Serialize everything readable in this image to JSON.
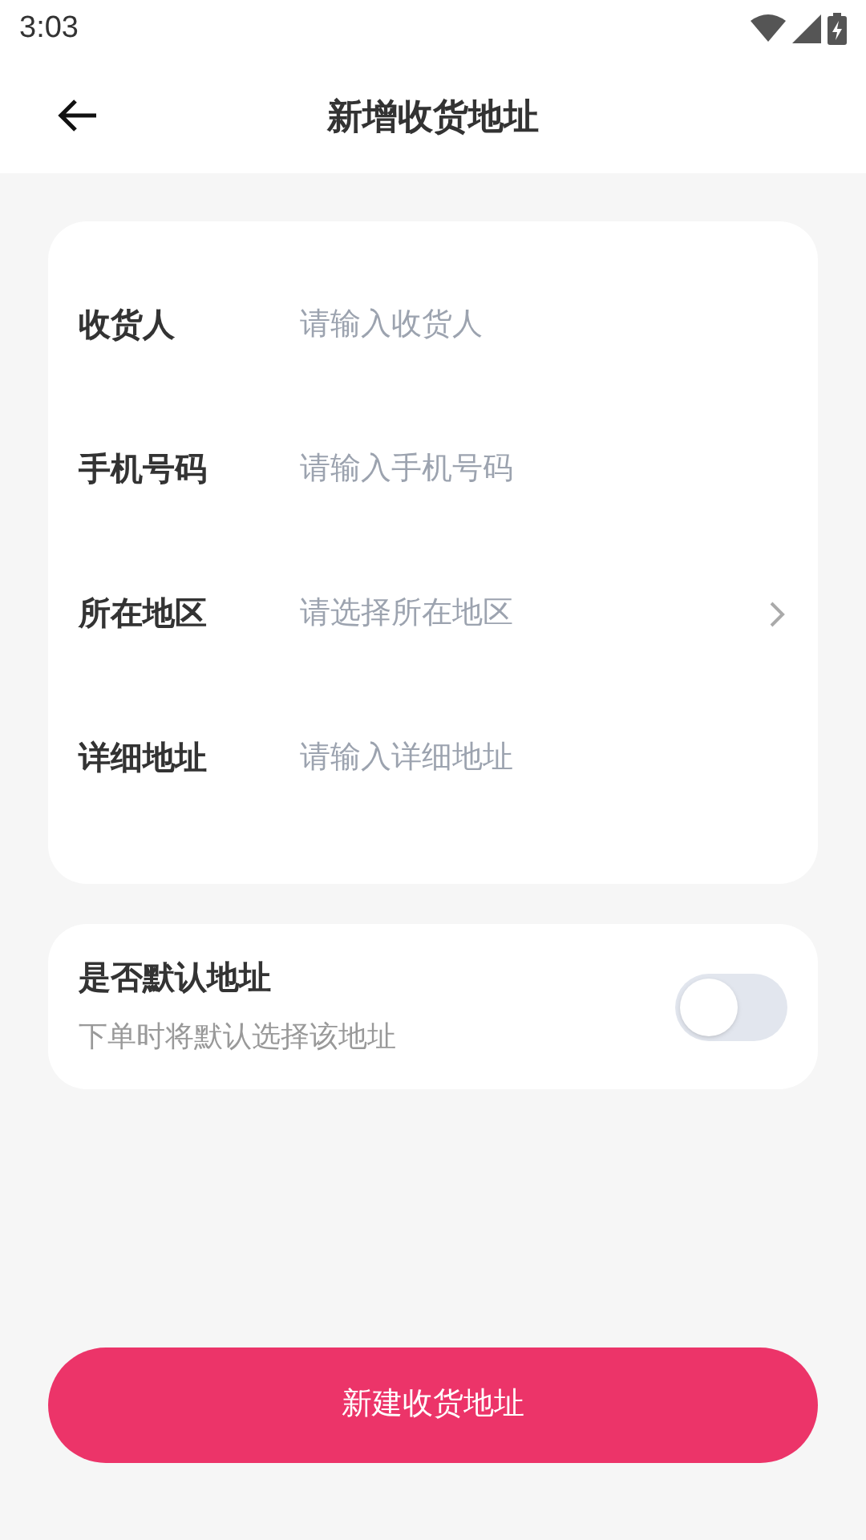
{
  "status_bar": {
    "time": "3:03"
  },
  "header": {
    "title": "新增收货地址"
  },
  "form": {
    "fields": [
      {
        "label": "收货人",
        "placeholder": "请输入收货人",
        "kind": "input"
      },
      {
        "label": "手机号码",
        "placeholder": "请输入手机号码",
        "kind": "input"
      },
      {
        "label": "所在地区",
        "placeholder": "请选择所在地区",
        "kind": "select"
      },
      {
        "label": "详细地址",
        "placeholder": "请输入详细地址",
        "kind": "input"
      }
    ]
  },
  "default_setting": {
    "title": "是否默认地址",
    "description": "下单时将默认选择该地址",
    "on": false
  },
  "submit_button": {
    "label": "新建收货地址"
  }
}
